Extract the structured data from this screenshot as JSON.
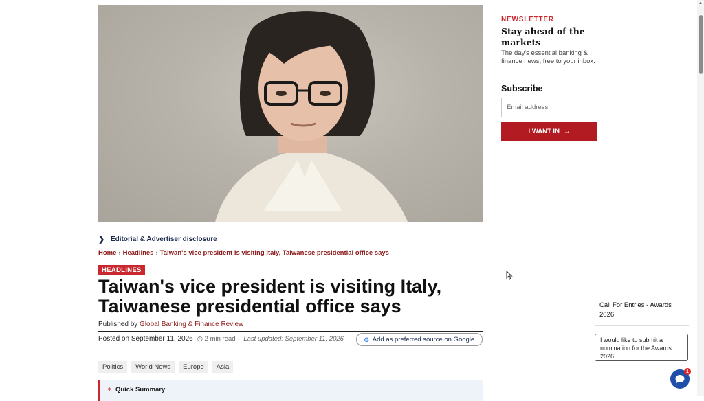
{
  "article": {
    "disclosure_label": "Editorial & Advertiser disclosure",
    "breadcrumb": [
      "Home",
      "Headlines",
      "Taiwan's vice president is visiting Italy, Taiwanese presidential office says"
    ],
    "category_badge": "HEADLINES",
    "title": "Taiwan's vice president is visiting Italy, Taiwanese presidential office says",
    "published_by_label": "Published by",
    "publisher": "Global Banking & Finance Review",
    "posted_on": "Posted on September 11, 2026",
    "read_time": "2 min read",
    "last_updated": "· Last updated: September 11, 2026",
    "google_button": "Add as preferred source on Google",
    "tags": [
      "Politics",
      "World News",
      "Europe",
      "Asia"
    ],
    "quick_summary": "Quick Summary"
  },
  "newsletter": {
    "label": "NEWSLETTER",
    "title": "Stay ahead of the markets",
    "description": "The day's essential banking & finance news, free to your inbox.",
    "subscribe_label": "Subscribe",
    "email_placeholder": "Email address",
    "button_label": "I WANT IN"
  },
  "widget": {
    "awards_text": "Call For Entries - Awards 2026",
    "message_text": "I would like to submit a nomination for the Awards 2026",
    "chat_badge_count": "1"
  },
  "colors": {
    "accent": "#c8282e",
    "link": "#8b1a1a",
    "chat": "#1f4fa8"
  }
}
